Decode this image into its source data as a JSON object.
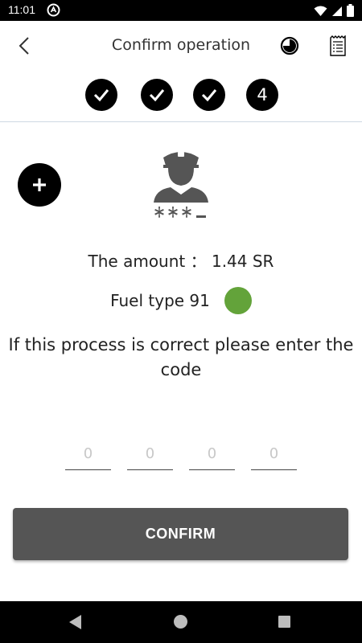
{
  "status_bar": {
    "time": "11:01",
    "icons": [
      "app-notification-icon",
      "wifi-icon",
      "signal-icon",
      "battery-icon"
    ]
  },
  "header": {
    "title": "Confirm operation",
    "back_icon": "chevron-left-icon",
    "actions": [
      "history-icon",
      "receipt-icon"
    ]
  },
  "stepper": {
    "steps": [
      {
        "state": "done",
        "label": "✓"
      },
      {
        "state": "done",
        "label": "✓"
      },
      {
        "state": "done",
        "label": "✓"
      },
      {
        "state": "current",
        "label": "4"
      }
    ]
  },
  "driver": {
    "icon": "driver-avatar-icon",
    "masked_id": "***_"
  },
  "amount": {
    "text": "The amount ： 1.44  SR"
  },
  "fuel": {
    "label": "Fuel type 91",
    "color": "#63a33a"
  },
  "instruction": "If this process is correct please enter the code",
  "code_fields": [
    {
      "placeholder": "0",
      "value": ""
    },
    {
      "placeholder": "0",
      "value": ""
    },
    {
      "placeholder": "0",
      "value": ""
    },
    {
      "placeholder": "0",
      "value": ""
    }
  ],
  "confirm_label": "CONFIRM",
  "colors": {
    "accent": "#000000",
    "button": "#555555",
    "fuel_91": "#63a33a"
  }
}
